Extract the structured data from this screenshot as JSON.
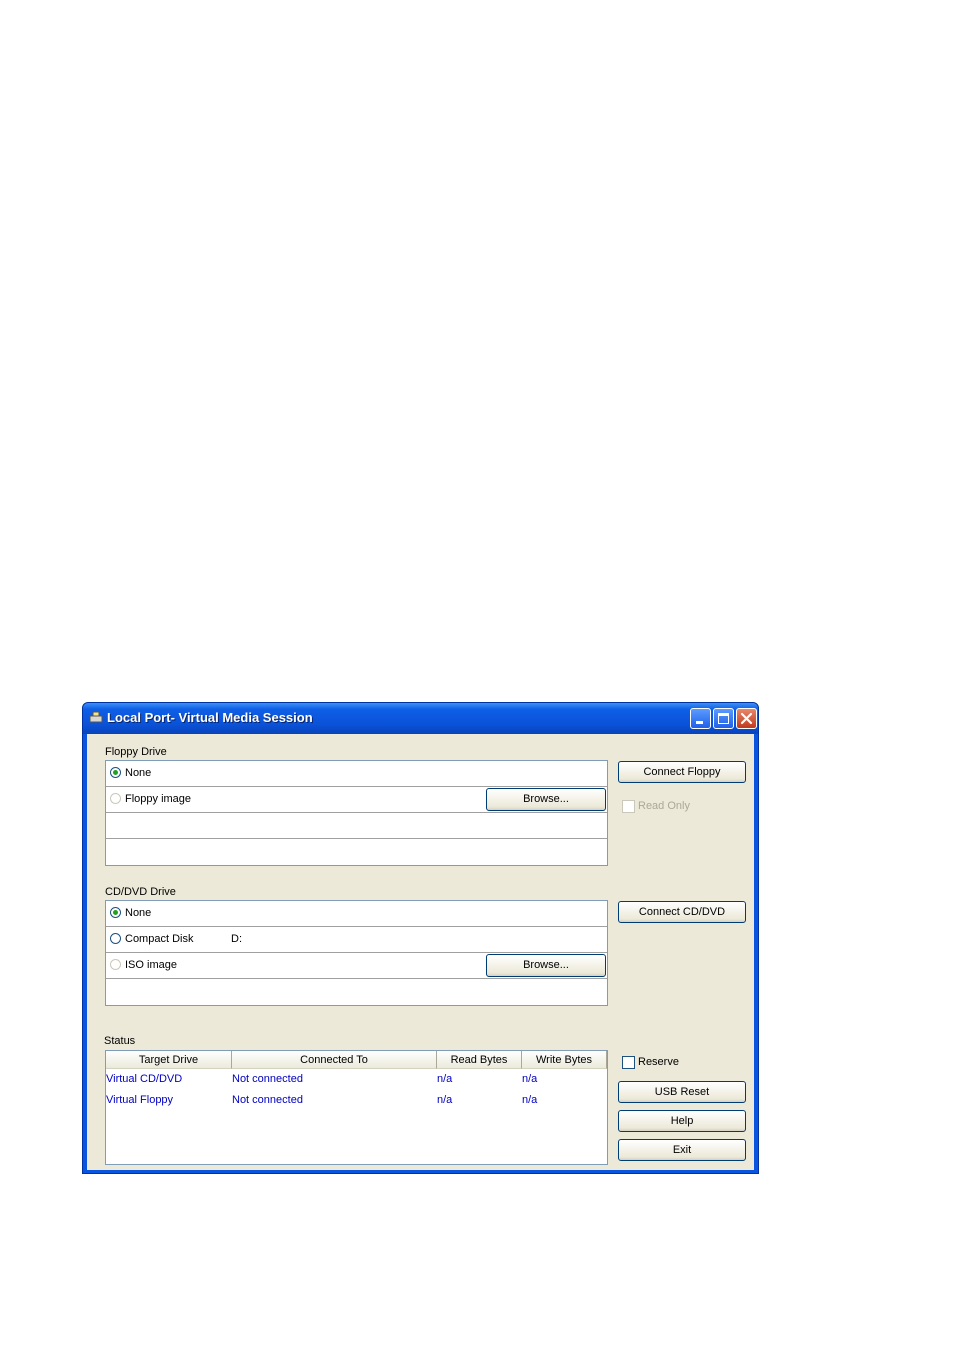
{
  "window": {
    "title": "Local Port- Virtual Media Session"
  },
  "floppy": {
    "label": "Floppy Drive",
    "none_label": "None",
    "image_label": "Floppy image",
    "browse_label": "Browse...",
    "connect_label": "Connect Floppy",
    "read_only_label": "Read Only"
  },
  "cddvd": {
    "label": "CD/DVD Drive",
    "none_label": "None",
    "compact_label": "Compact Disk",
    "compact_drive": "D:",
    "iso_label": "ISO image",
    "browse_label": "Browse...",
    "connect_label": "Connect CD/DVD"
  },
  "status": {
    "label": "Status",
    "columns": [
      "Target Drive",
      "Connected To",
      "Read Bytes",
      "Write Bytes"
    ],
    "rows": [
      [
        "Virtual CD/DVD",
        "Not connected",
        "n/a",
        "n/a"
      ],
      [
        "Virtual Floppy",
        "Not connected",
        "n/a",
        "n/a"
      ]
    ]
  },
  "controls": {
    "reserve_label": "Reserve",
    "usb_reset_label": "USB Reset",
    "help_label": "Help",
    "exit_label": "Exit"
  },
  "colors": {
    "title_bar": "#0a55e0",
    "client_bg": "#ece9d8",
    "status_text": "#0000c0"
  }
}
